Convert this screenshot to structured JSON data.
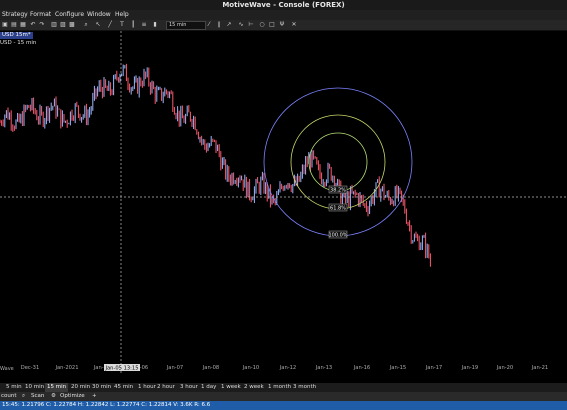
{
  "window": {
    "title": "MotiveWave - Console (FOREX)"
  },
  "menu": [
    "Strategy",
    "Format",
    "Configure",
    "Window",
    "Help"
  ],
  "toolbar": {
    "bar_size": "15 min"
  },
  "chart": {
    "tab_label": "USD 15m*",
    "symbol_label": "USD - 15 min",
    "x_labels": [
      "Dec-31",
      "Jan-2021",
      "Jan-05",
      "Jan-06",
      "Jan-07",
      "Jan-08",
      "Jan-10",
      "Jan-12",
      "Jan-13",
      "Jan-16",
      "Jan-15",
      "Jan-17",
      "Jan-19",
      "Jan-20",
      "Jan-21"
    ],
    "crosshair_label": "Jan-05 13:15",
    "fib_labels": [
      "38.2%",
      "61.8%",
      "100.0%"
    ],
    "watermark": "Wave",
    "colors": {
      "up": "#9ab8ff",
      "down": "#ff5a6e",
      "circle_outer": "#7c84ff",
      "circle_mid": "#c9d66a",
      "circle_inner": "#b9e27c"
    }
  },
  "chart_data": {
    "type": "line",
    "x": [
      "Dec-31",
      "Jan-2021",
      "Jan-05",
      "Jan-06",
      "Jan-07",
      "Jan-08",
      "Jan-10",
      "Jan-12",
      "Jan-13",
      "Jan-16",
      "Jan-15",
      "Jan-17"
    ],
    "series": [
      {
        "values": [
          1.2265,
          1.2275,
          1.227,
          1.2305,
          1.2295,
          1.226,
          1.2215,
          1.22,
          1.223,
          1.2195,
          1.2205,
          1.214
        ]
      }
    ]
  },
  "bar_sizes": [
    "5 min",
    "10 min",
    "15 min",
    "20 min",
    "30 min",
    "45 min",
    "1 hour",
    "2 hour",
    "3 hour",
    "1 day",
    "1 week",
    "2 week",
    "1 month",
    "3 month"
  ],
  "selected_bar_size": "15 min",
  "bottom_tabs": [
    "count",
    "Scan",
    "Optimize",
    "+"
  ],
  "status": {
    "text": "15:45: 1.21796 C: 1.22784 H: 1.22842 L: 1.22774 C: 1.22814 V: 3.6K R: 6.6"
  }
}
